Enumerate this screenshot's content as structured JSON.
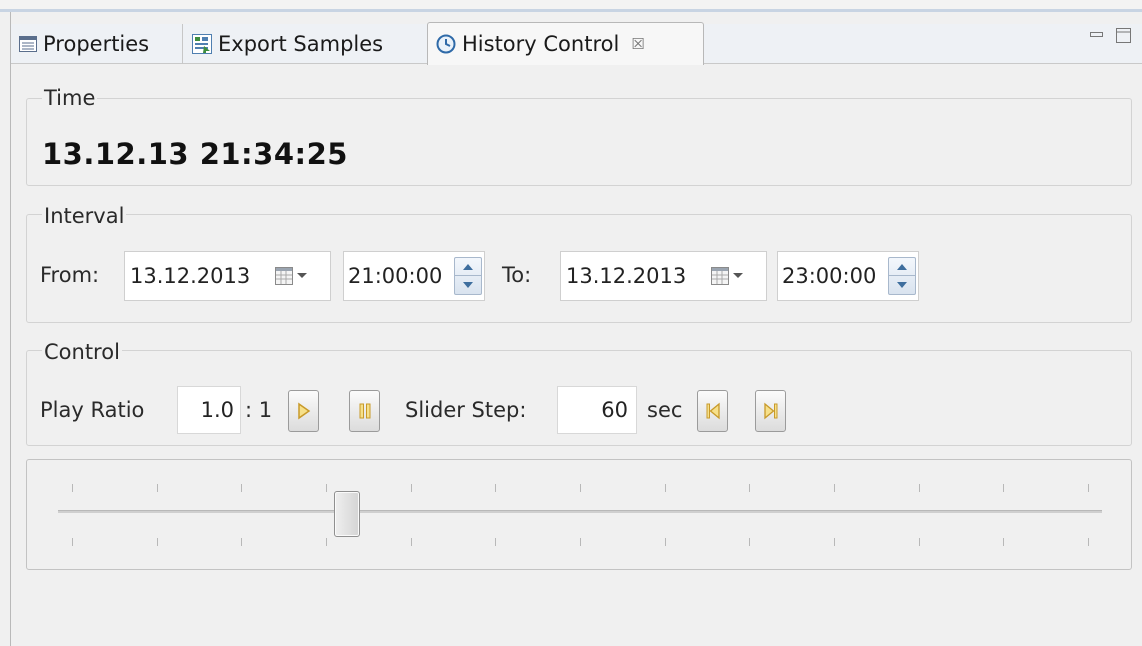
{
  "tabs": [
    {
      "label": "Properties",
      "icon": "properties-icon"
    },
    {
      "label": "Export Samples",
      "icon": "export-samples-icon"
    },
    {
      "label": "History Control",
      "icon": "history-clock-icon",
      "active": true,
      "close_glyph": "☒"
    }
  ],
  "view_controls": {
    "minimize_glyph": "▭",
    "maximize_glyph": "□"
  },
  "time_group": {
    "title": "Time",
    "value": "13.12.13 21:34:25"
  },
  "interval_group": {
    "title": "Interval",
    "from_label": "From:",
    "from_date": "13.12.2013",
    "from_time": "21:00:00",
    "to_label": "To:",
    "to_date": "13.12.2013",
    "to_time": "23:00:00"
  },
  "control_group": {
    "title": "Control",
    "play_ratio_label": "Play Ratio",
    "play_ratio_value": "1.0",
    "ratio_suffix": ": 1",
    "slider_step_label": "Slider Step:",
    "slider_step_value": "60",
    "slider_step_unit": "sec"
  },
  "slider": {
    "position_fraction": 0.277,
    "tick_count": 13
  },
  "colors": {
    "accent_icon": "#c89a2a",
    "tab_bar": "#eef1f5",
    "panel_bg": "#f0f0f0"
  }
}
